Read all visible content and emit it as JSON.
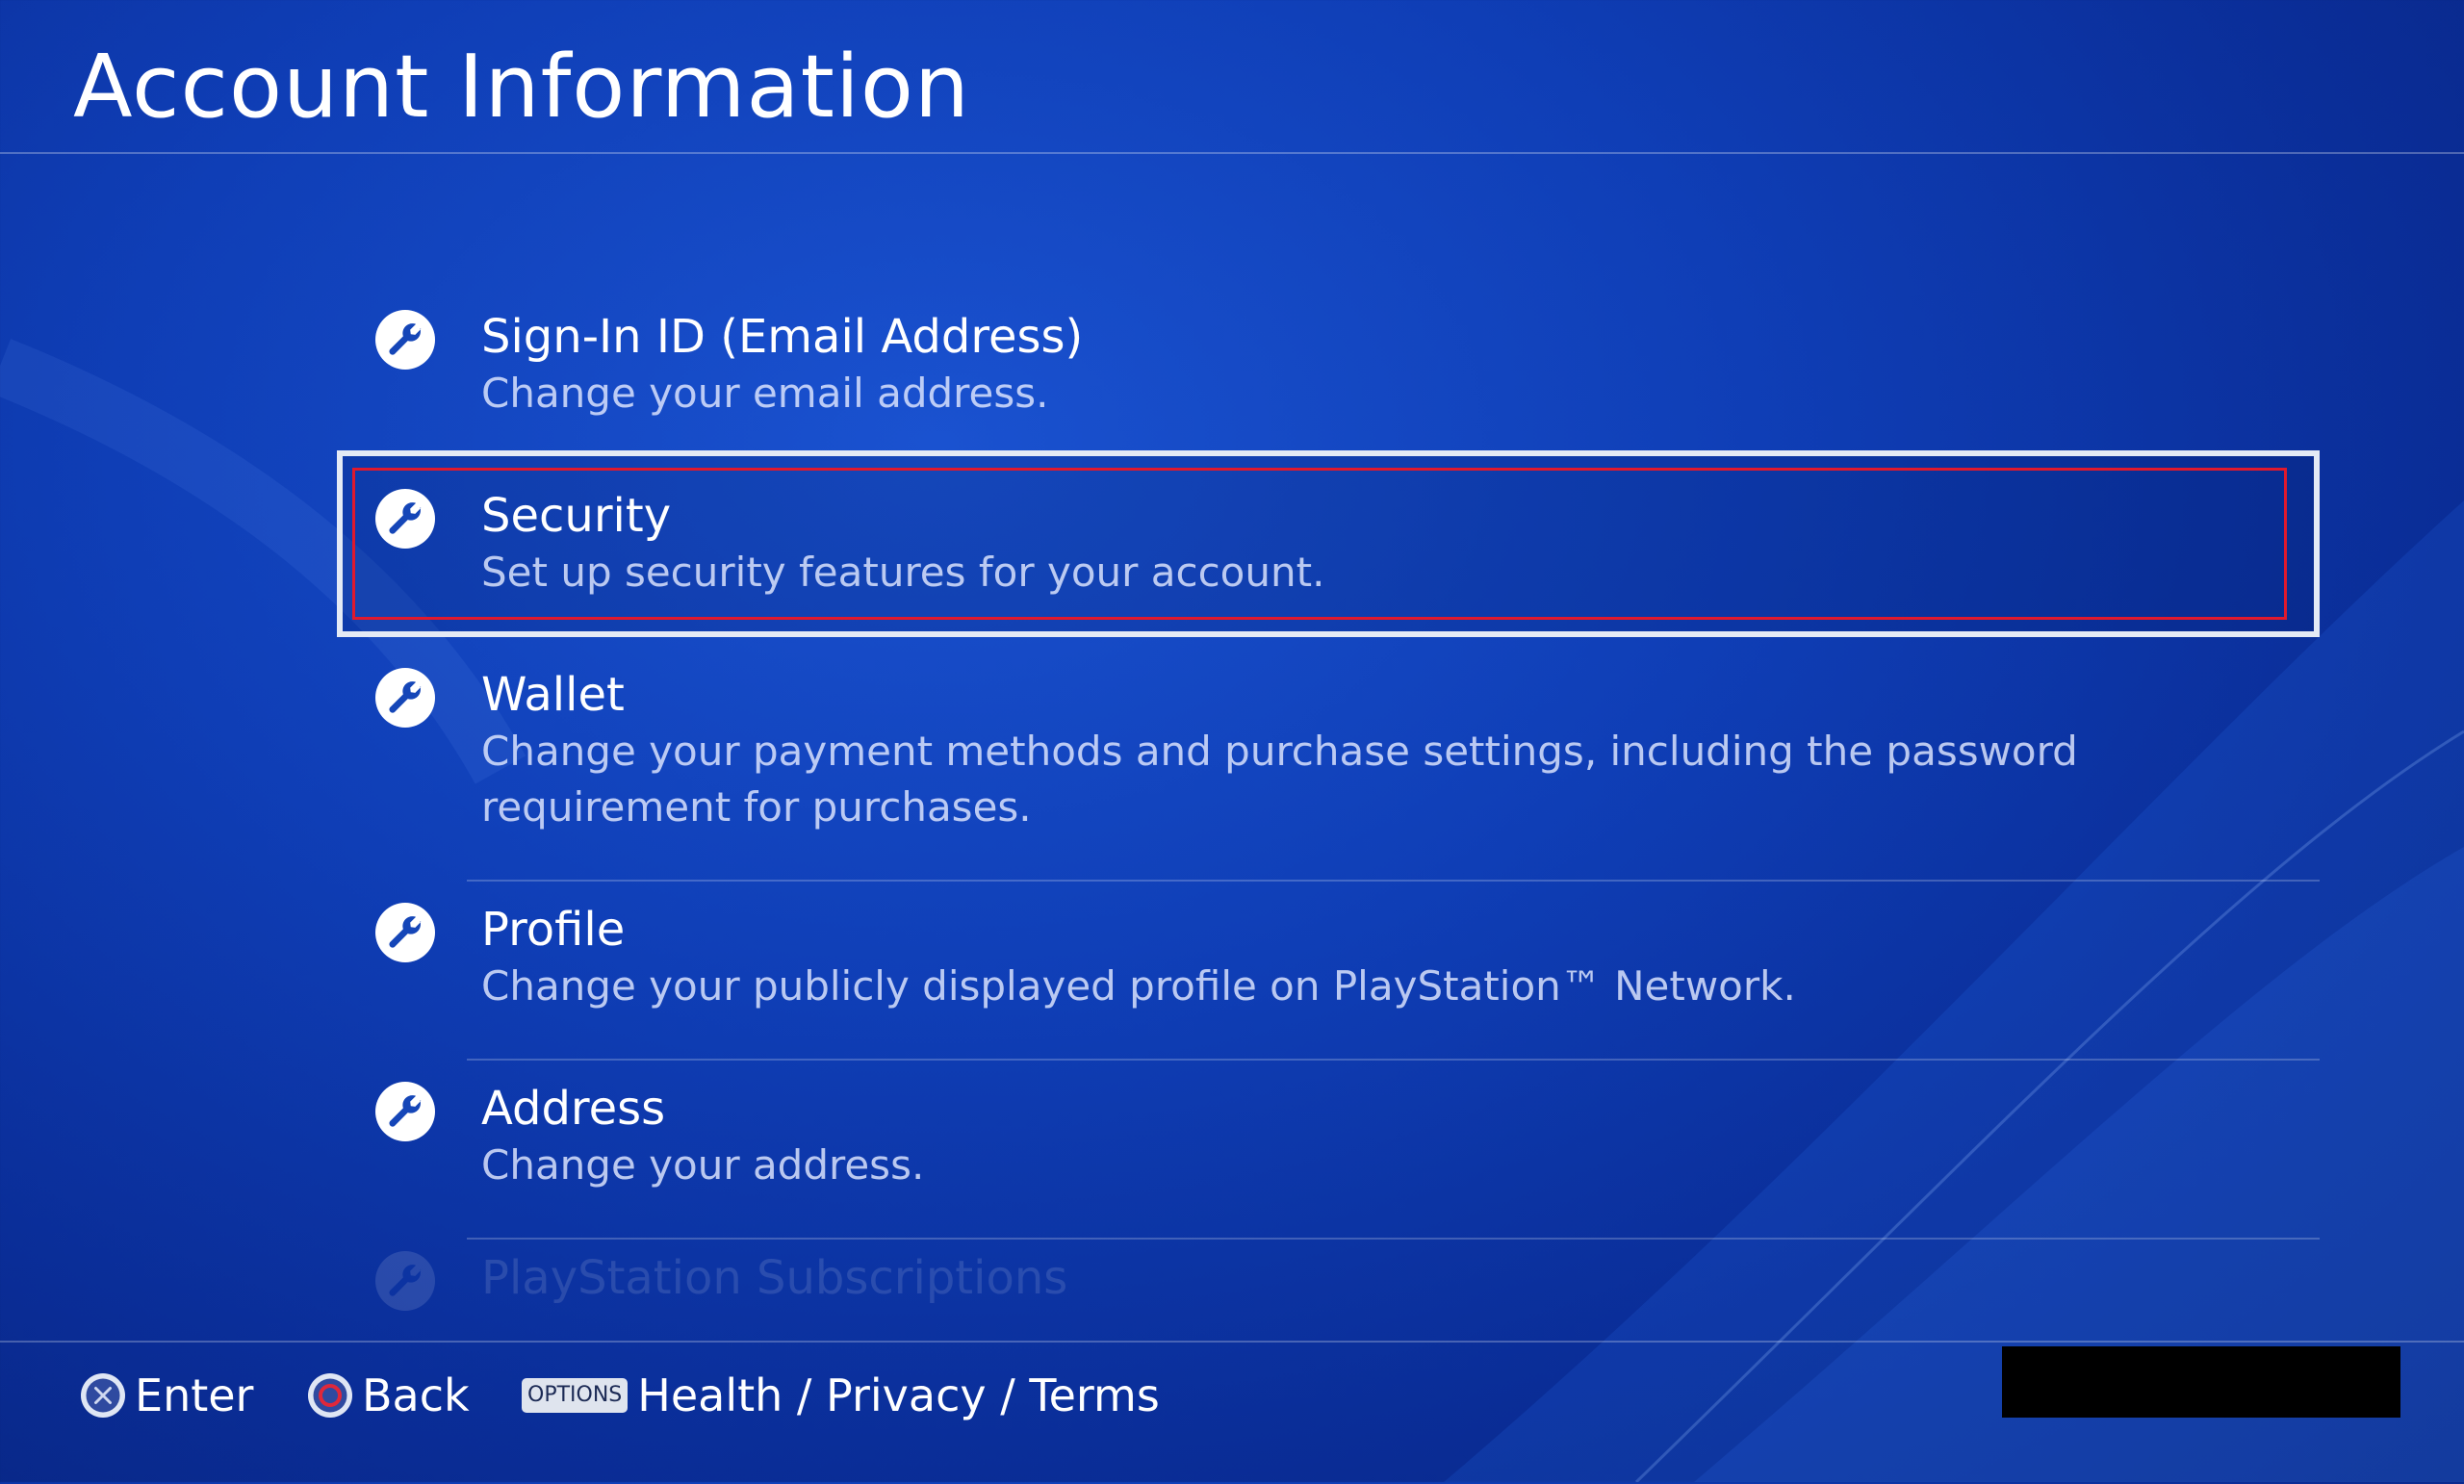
{
  "header": {
    "title": "Account Information"
  },
  "menu": {
    "items": [
      {
        "label": "Sign-In ID (Email Address)",
        "description": "Change your email address.",
        "icon": "wrench-icon"
      },
      {
        "label": "Security",
        "description": "Set up security features for your account.",
        "icon": "wrench-icon",
        "selected": true
      },
      {
        "label": "Wallet",
        "description": "Change your payment methods and purchase settings, including the password requirement for purchases.",
        "icon": "wrench-icon"
      },
      {
        "label": "Profile",
        "description": "Change your publicly displayed profile on PlayStation™ Network.",
        "icon": "wrench-icon"
      },
      {
        "label": "Address",
        "description": "Change your address.",
        "icon": "wrench-icon"
      },
      {
        "label": "PlayStation Subscriptions",
        "icon": "wrench-icon"
      }
    ]
  },
  "footer": {
    "enter_label": "Enter",
    "back_label": "Back",
    "options_key": "OPTIONS",
    "options_label": "Health / Privacy / Terms"
  },
  "colors": {
    "background": "#0f3eb6",
    "selection_frame": "#e4eaf5",
    "highlight_red": "#e0192d"
  }
}
